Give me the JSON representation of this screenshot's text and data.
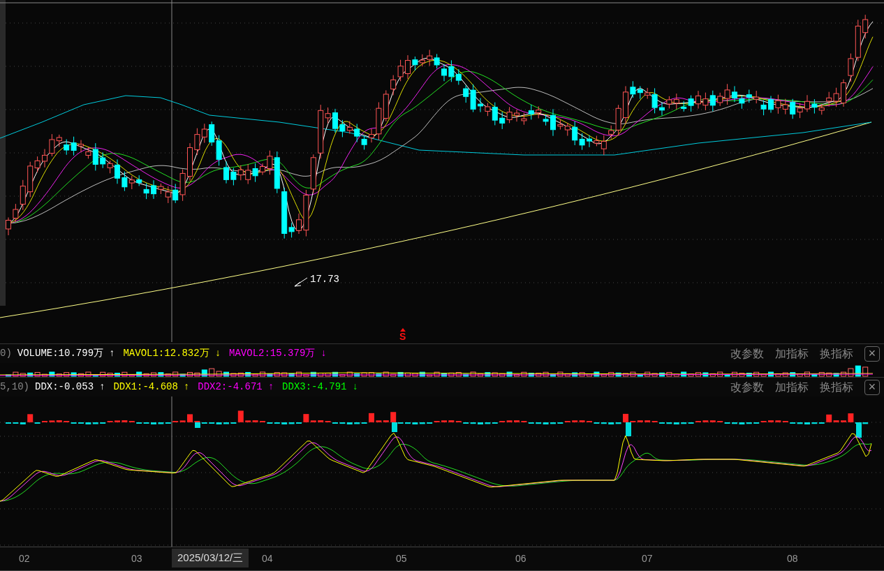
{
  "price_panel": {
    "low_marker": "17.73",
    "signal_mark": "S"
  },
  "volume_panel": {
    "params": "0)",
    "indicators": [
      {
        "text": "VOLUME:10.799万",
        "arrow": "↑",
        "color": "#ffffff"
      },
      {
        "text": "MAVOL1:12.832万",
        "arrow": "↓",
        "color": "#ffff00"
      },
      {
        "text": "MAVOL2:15.379万",
        "arrow": "↓",
        "color": "#ff00ff"
      }
    ],
    "buttons": [
      "改参数",
      "加指标",
      "换指标"
    ],
    "close": "×"
  },
  "ddx_panel": {
    "params": "5,10)",
    "indicators": [
      {
        "text": "DDX:-0.053",
        "arrow": "↑",
        "color": "#ffffff"
      },
      {
        "text": "DDX1:-4.608",
        "arrow": "↑",
        "color": "#ffff00"
      },
      {
        "text": "DDX2:-4.671",
        "arrow": "↑",
        "color": "#ff00ff"
      },
      {
        "text": "DDX3:-4.791",
        "arrow": "↓",
        "color": "#00ff00"
      }
    ],
    "buttons": [
      "改参数",
      "加指标",
      "换指标"
    ],
    "close": "×"
  },
  "x_axis": {
    "labels": [
      "02",
      "03",
      "04",
      "05",
      "06",
      "07",
      "08"
    ],
    "cursor_date": "2025/03/12/三"
  }
}
